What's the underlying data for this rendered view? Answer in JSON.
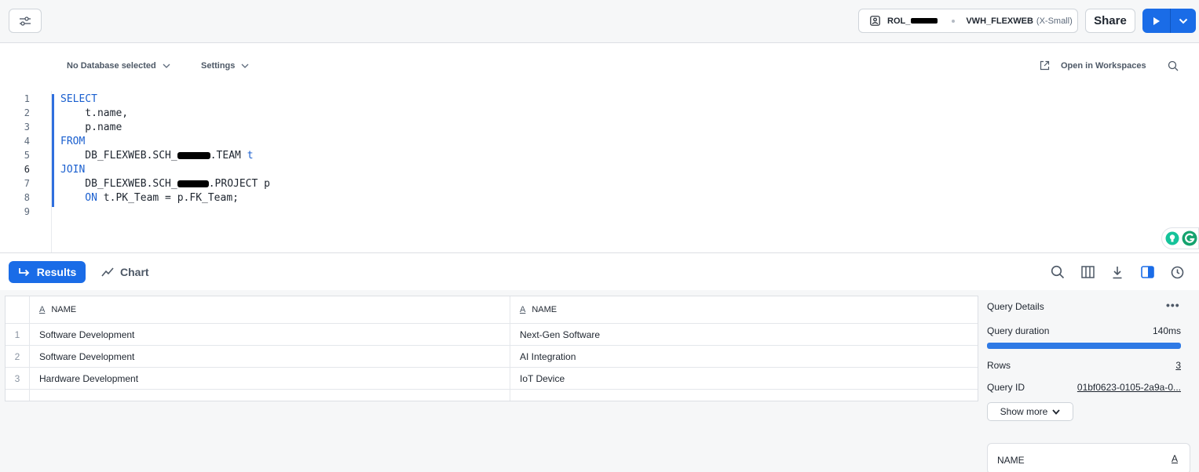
{
  "topbar": {
    "role": "ROL_",
    "warehouse": "VWH_FLEXWEB",
    "warehouse_size": "(X-Small)",
    "share_label": "Share"
  },
  "editor_toolbar": {
    "database": "No Database selected",
    "settings": "Settings",
    "open_workspaces": "Open in Workspaces"
  },
  "code": {
    "line_numbers": [
      "1",
      "2",
      "3",
      "4",
      "5",
      "6",
      "7",
      "8",
      "9"
    ],
    "lines": [
      {
        "kw": "SELECT",
        "text": ""
      },
      {
        "kw": "",
        "text": "    t.name,"
      },
      {
        "kw": "",
        "text": "    p.name"
      },
      {
        "kw": "FROM",
        "text": ""
      },
      {
        "kw": "",
        "text": "    DB_FLEXWEB.SCH_",
        "after": ".TEAM ",
        "alias": "t"
      },
      {
        "kw": "JOIN",
        "text": ""
      },
      {
        "kw": "",
        "text": "    DB_FLEXWEB.SCH_",
        "after": ".PROJECT p"
      },
      {
        "kw": "    ON",
        "text": " t.PK_Team = p.FK_Team;"
      }
    ]
  },
  "results_bar": {
    "results_tab": "Results",
    "chart_tab": "Chart"
  },
  "grid": {
    "columns": [
      "NAME",
      "NAME"
    ],
    "rows": [
      {
        "idx": "1",
        "c1": "Software Development",
        "c2": "Next-Gen Software"
      },
      {
        "idx": "2",
        "c1": "Software Development",
        "c2": "AI Integration"
      },
      {
        "idx": "3",
        "c1": "Hardware Development",
        "c2": "IoT Device"
      }
    ]
  },
  "query_details": {
    "title": "Query Details",
    "duration_label": "Query duration",
    "duration_value": "140ms",
    "duration_fraction": 1.0,
    "rows_label": "Rows",
    "rows_value": "3",
    "query_id_label": "Query ID",
    "query_id_value": "01bf0623-0105-2a9a-0...",
    "show_more": "Show more",
    "column_card_name": "NAME",
    "column_card_type": "A"
  },
  "colors": {
    "accent": "#1a6ce7",
    "keyword": "#1a5fcf"
  }
}
